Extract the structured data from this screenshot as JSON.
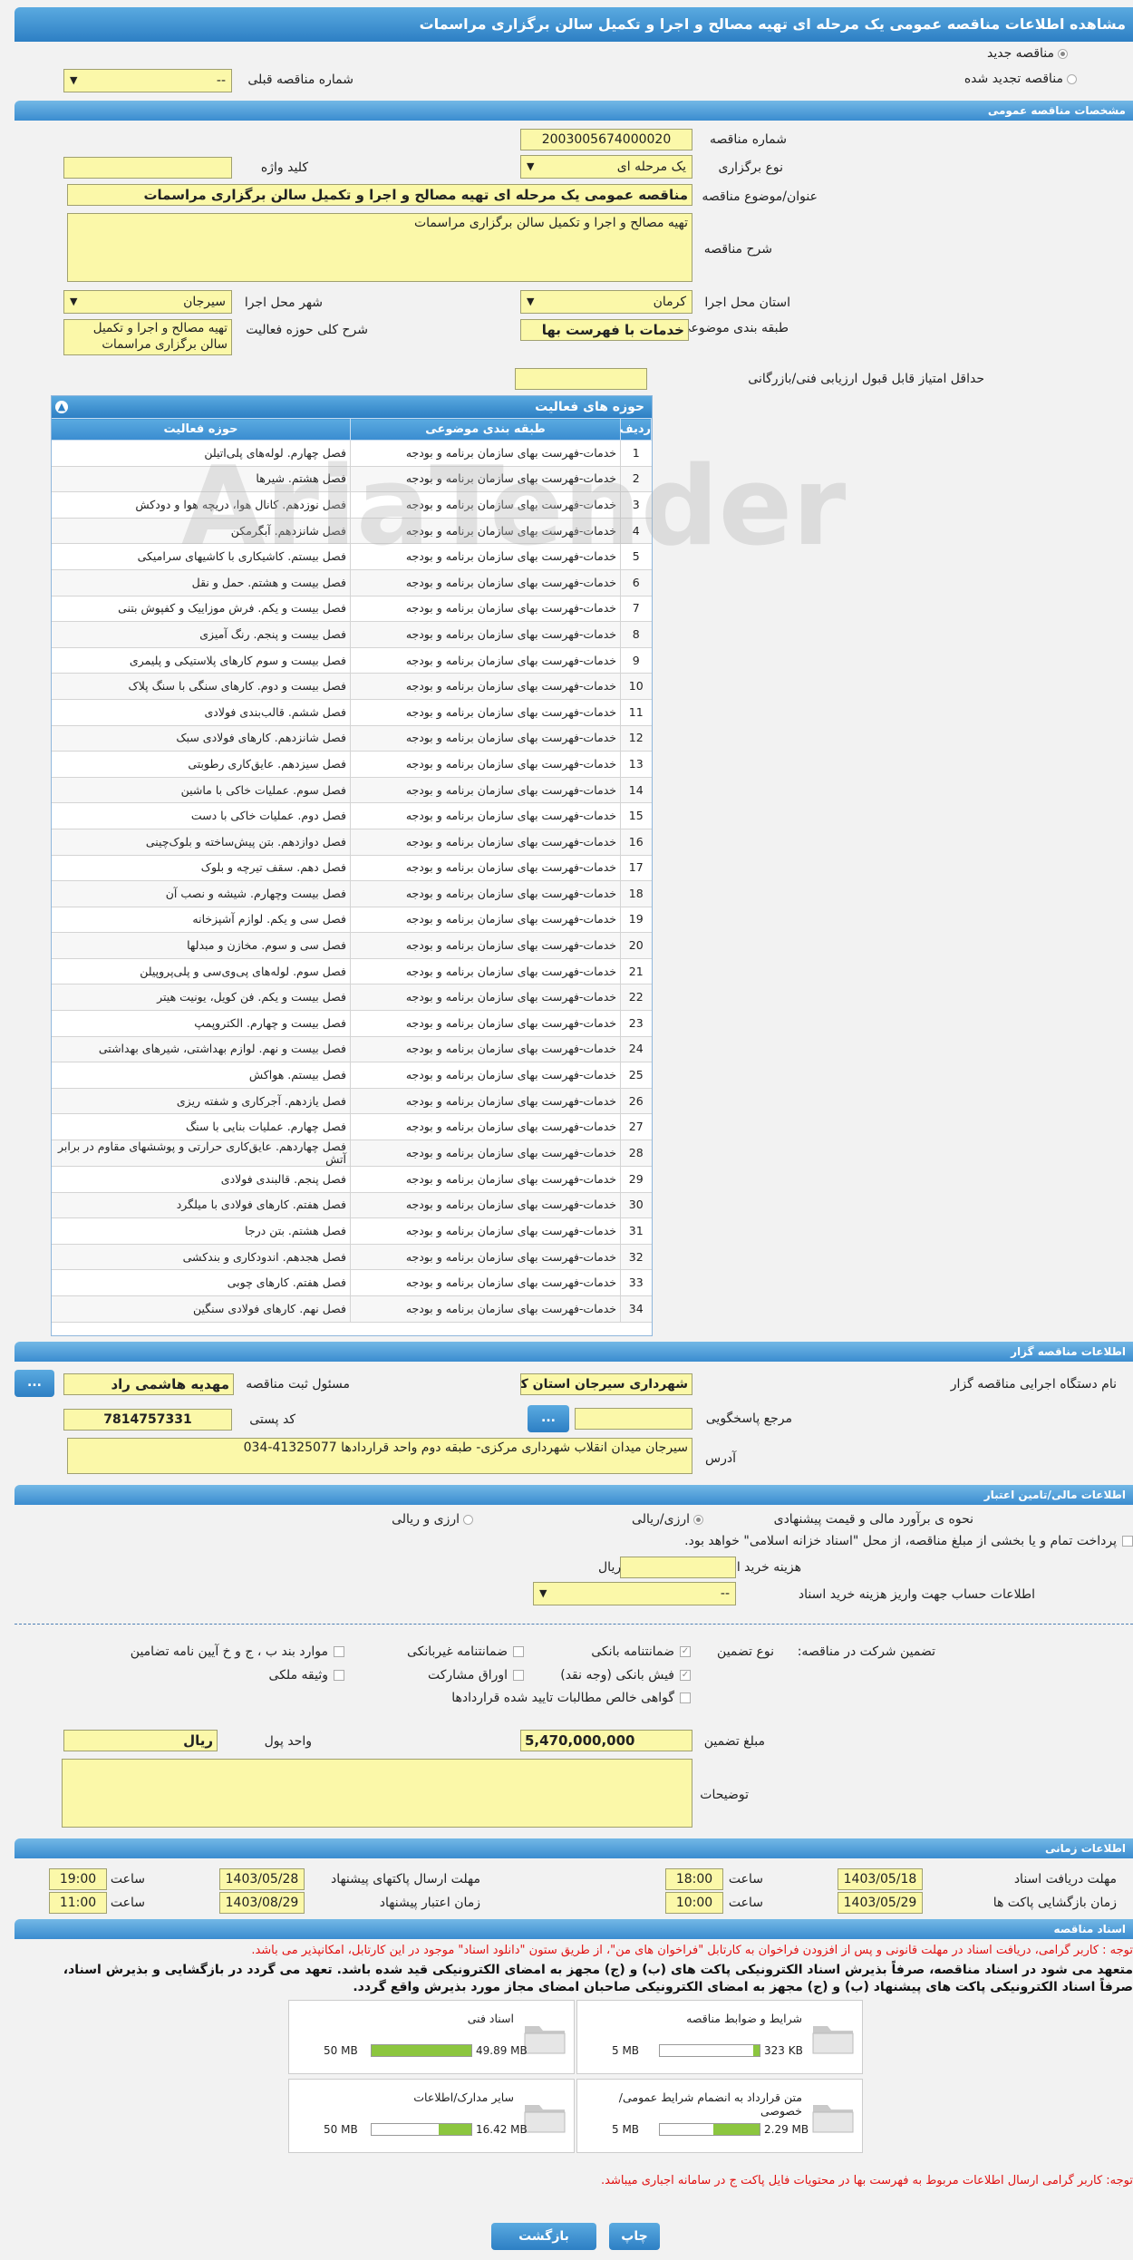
{
  "page_title": "مشاهده اطلاعات مناقصه عمومی یک مرحله ای تهیه مصالح و اجرا و تکمیل سالن برگزاری مراسمات",
  "top": {
    "radio_new": "مناقصه جدید",
    "radio_renew": "مناقصه تجدید شده",
    "prev_number_label": "شماره مناقصه قبلی",
    "prev_number_value": "--"
  },
  "sections": {
    "general": "مشخصات مناقصه عمومی",
    "organizer": "اطلاعات مناقصه گزار",
    "financial": "اطلاعات مالی/تامین اعتبار",
    "timing": "اطلاعات زمانی",
    "documents": "اسناد مناقصه"
  },
  "general": {
    "number_label": "شماره مناقصه",
    "number_value": "2003005674000020",
    "type_label": "نوع برگزاری",
    "type_value": "یک مرحله ای",
    "keyword_label": "کلید واژه",
    "keyword_value": "",
    "subject_label": "عنوان/موضوع مناقصه",
    "subject_value": "مناقصه عمومی یک مرحله ای تهیه مصالح و اجرا و تکمیل سالن برگزاری مراسمات",
    "desc_label": "شرح مناقصه",
    "desc_value": "تهیه مصالح و اجرا و تکمیل سالن برگزاری مراسمات",
    "province_label": "استان محل اجرا",
    "province_value": "کرمان",
    "city_label": "شهر محل اجرا",
    "city_value": "سیرجان",
    "category_label": "طبقه بندی موضوعی",
    "category_value": "خدمات با فهرست بها",
    "activity_desc_label": "شرح کلی حوزه فعالیت",
    "activity_desc_value": "تهیه مصالح و اجرا و تکمیل سالن برگزاری مراسمات",
    "min_score_label": "حداقل امتیاز قابل قبول ارزیابی فنی/بازرگانی",
    "min_score_value": ""
  },
  "activities": {
    "title": "حوزه های فعالیت",
    "col_row": "ردیف",
    "col_category": "طبقه بندی موضوعی",
    "col_activity": "حوزه فعالیت",
    "rows": [
      [
        "1",
        "خدمات-فهرست بهای سازمان برنامه و بودجه",
        "فصل چهارم. لوله‌های پلی‌اتیلن"
      ],
      [
        "2",
        "خدمات-فهرست بهای سازمان برنامه و بودجه",
        "فصل هشتم. شیرها"
      ],
      [
        "3",
        "خدمات-فهرست بهای سازمان برنامه و بودجه",
        "فصل نوزدهم. کانال هوا، دریچه هوا و دودکش"
      ],
      [
        "4",
        "خدمات-فهرست بهای سازمان برنامه و بودجه",
        "فصل شانزدهم. آبگرمکن"
      ],
      [
        "5",
        "خدمات-فهرست بهای سازمان برنامه و بودجه",
        "فصل بیستم. کاشیکاری با کاشیهای سرامیکی"
      ],
      [
        "6",
        "خدمات-فهرست بهای سازمان برنامه و بودجه",
        "فصل بیست و هشتم. حمل و نقل"
      ],
      [
        "7",
        "خدمات-فهرست بهای سازمان برنامه و بودجه",
        "فصل بیست و یکم. فرش موزاییک و کفپوش بتنی"
      ],
      [
        "8",
        "خدمات-فهرست بهای سازمان برنامه و بودجه",
        "فصل بیست و پنجم. رنگ آمیزی"
      ],
      [
        "9",
        "خدمات-فهرست بهای سازمان برنامه و بودجه",
        "فصل بیست و سوم کارهای پلاستیکی و پلیمری"
      ],
      [
        "10",
        "خدمات-فهرست بهای سازمان برنامه و بودجه",
        "فصل بیست و دوم. کارهای سنگی با سنگ پلاک"
      ],
      [
        "11",
        "خدمات-فهرست بهای سازمان برنامه و بودجه",
        "فصل ششم. قالب‌بندی فولادی"
      ],
      [
        "12",
        "خدمات-فهرست بهای سازمان برنامه و بودجه",
        "فصل شانزدهم. کارهای فولادی سبک"
      ],
      [
        "13",
        "خدمات-فهرست بهای سازمان برنامه و بودجه",
        "فصل سیزدهم. عایق‌کاری رطوبتی"
      ],
      [
        "14",
        "خدمات-فهرست بهای سازمان برنامه و بودجه",
        "فصل سوم. عملیات خاکی با ماشین"
      ],
      [
        "15",
        "خدمات-فهرست بهای سازمان برنامه و بودجه",
        "فصل دوم. عملیات خاکی با دست"
      ],
      [
        "16",
        "خدمات-فهرست بهای سازمان برنامه و بودجه",
        "فصل دوازدهم. بتن پیش‌ساخته و بلوک‌چینی"
      ],
      [
        "17",
        "خدمات-فهرست بهای سازمان برنامه و بودجه",
        "فصل دهم. سقف تیرچه و بلوک"
      ],
      [
        "18",
        "خدمات-فهرست بهای سازمان برنامه و بودجه",
        "فصل بیست وچهارم. شیشه و نصب آن"
      ],
      [
        "19",
        "خدمات-فهرست بهای سازمان برنامه و بودجه",
        "فصل سی و یکم. لوازم آشپزخانه"
      ],
      [
        "20",
        "خدمات-فهرست بهای سازمان برنامه و بودجه",
        "فصل سی و سوم. مخازن و مبدلها"
      ],
      [
        "21",
        "خدمات-فهرست بهای سازمان برنامه و بودجه",
        "فصل سوم. لوله‌های پی‌وی‌سی و پلی‌پروپیلن"
      ],
      [
        "22",
        "خدمات-فهرست بهای سازمان برنامه و بودجه",
        "فصل بیست و یکم. فن کویل، یونیت هیتر"
      ],
      [
        "23",
        "خدمات-فهرست بهای سازمان برنامه و بودجه",
        "فصل بیست و چهارم. الکتروپمپ"
      ],
      [
        "24",
        "خدمات-فهرست بهای سازمان برنامه و بودجه",
        "فصل بیست و نهم. لوازم بهداشتی، شیرهای بهداشتی"
      ],
      [
        "25",
        "خدمات-فهرست بهای سازمان برنامه و بودجه",
        "فصل بیستم. هواکش"
      ],
      [
        "26",
        "خدمات-فهرست بهای سازمان برنامه و بودجه",
        "فصل یازدهم. آجرکاری و شفته ریزی"
      ],
      [
        "27",
        "خدمات-فهرست بهای سازمان برنامه و بودجه",
        "فصل چهارم. عملیات بنایی با سنگ"
      ],
      [
        "28",
        "خدمات-فهرست بهای سازمان برنامه و بودجه",
        "فصل چهاردهم. عایق‌کاری حرارتی و پوششهای مقاوم در برابر آتش"
      ],
      [
        "29",
        "خدمات-فهرست بهای سازمان برنامه و بودجه",
        "فصل پنجم. قالبندی فولادی"
      ],
      [
        "30",
        "خدمات-فهرست بهای سازمان برنامه و بودجه",
        "فصل هفتم. کارهای فولادی با میلگرد"
      ],
      [
        "31",
        "خدمات-فهرست بهای سازمان برنامه و بودجه",
        "فصل هشتم. بتن درجا"
      ],
      [
        "32",
        "خدمات-فهرست بهای سازمان برنامه و بودجه",
        "فصل هجدهم. اندودکاری و بندکشی"
      ],
      [
        "33",
        "خدمات-فهرست بهای سازمان برنامه و بودجه",
        "فصل هفتم. کارهای چوبی"
      ],
      [
        "34",
        "خدمات-فهرست بهای سازمان برنامه و بودجه",
        "فصل نهم. کارهای فولادی سنگین"
      ]
    ]
  },
  "organizer": {
    "org_label": "نام دستگاه اجرایی مناقصه گزار",
    "org_value": "شهرداری سیرجان استان کرمان",
    "responsible_label": "مسئول ثبت مناقصه",
    "responsible_value": "مهدیه هاشمی راد",
    "ref_label": "مرجع پاسخگویی",
    "ref_value": "",
    "postal_label": "کد پستی",
    "postal_value": "7814757331",
    "address_label": "آدرس",
    "address_value": "سیرجان میدان انقلاب شهرداری مرکزی- طبقه دوم واحد قراردادها 41325077-034",
    "dots_button": "..."
  },
  "financial": {
    "estimate_label": "نحوه ی برآورد مالی و قیمت پیشنهادی",
    "opt_currency_rial": "ارزی/ریالی",
    "opt_currency_and_rial": "ارزی و ریالی",
    "treasury_note": "پرداخت تمام و یا بخشی از مبلغ مناقصه، از محل \"اسناد خزانه اسلامی\" خواهد بود.",
    "doc_cost_label": "هزینه خرید اسناد",
    "doc_cost_unit": "ریال",
    "account_label": "اطلاعات حساب جهت واریز هزینه خرید اسناد",
    "account_value": "--",
    "guarantee_label": "تضمین شرکت در مناقصه:",
    "guarantee_type_label": "نوع تضمین",
    "g_bank": "ضمانتنامه بانکی",
    "g_nonbank": "ضمانتنامه غیربانکی",
    "g_items": "موارد بند ب ، ج و خ آیین نامه تضامین",
    "g_cash": "فیش بانکی (وجه نقد)",
    "g_bonds": "اوراق مشارکت",
    "g_property": "وثیقه ملکی",
    "g_claims": "گواهی خالص مطالبات تایید شده قراردادها",
    "amount_label": "مبلغ تضمین",
    "amount_value": "5,470,000,000",
    "currency_label": "واحد پول",
    "currency_value": "ریال",
    "notes_label": "توضیحات",
    "notes_value": ""
  },
  "timing": {
    "receive_label": "مهلت دریافت اسناد",
    "receive_date": "1403/05/18",
    "receive_time": "18:00",
    "send_label": "مهلت ارسال پاکتهای پیشنهاد",
    "send_date": "1403/05/28",
    "send_time": "19:00",
    "open_label": "زمان بازگشایی پاکت ها",
    "open_date": "1403/05/29",
    "open_time": "10:00",
    "valid_label": "زمان اعتبار پیشنهاد",
    "valid_date": "1403/08/29",
    "valid_time": "11:00",
    "time_label": "ساعت"
  },
  "documents": {
    "note1": "توجه : کاربر گرامی، دریافت اسناد در مهلت قانونی و پس از افزودن فراخوان به کارتابل \"فراخوان های من\"، از طریق ستون \"دانلود اسناد\" موجود در این کارتابل، امکانپذیر می باشد.",
    "commit1": "متعهد می شود در اسناد مناقصه، صرفاً بذیرش اسناد الکترونیکی پاکت های (ب) و (ج) مجهز به امضای الکترونیکی قید شده باشد. تعهد می گردد در بازگشایی و بذیرش اسناد،",
    "commit2": "صرفاً اسناد الکترونیکی پاکت های پیشنهاد (ب) و (ج) مجهز به امضای الکترونیکی صاحبان امضای مجاز مورد بذیرش واقع گردد.",
    "files": [
      {
        "name": "شرایط و ضوابط مناقصه",
        "size": "323 KB",
        "max": "5 MB",
        "ratio": 0.06
      },
      {
        "name": "اسناد فنی",
        "size": "49.89 MB",
        "max": "50 MB",
        "ratio": 0.998
      },
      {
        "name": "متن قرارداد به انضمام شرایط عمومی/خصوصی",
        "size": "2.29 MB",
        "max": "5 MB",
        "ratio": 0.46
      },
      {
        "name": "سایر مدارک/اطلاعات",
        "size": "16.42 MB",
        "max": "50 MB",
        "ratio": 0.33
      }
    ],
    "note2": "توجه: کاربر گرامی ارسال اطلاعات مربوط به فهرست بها در محتویات فایل پاکت ج در سامانه اجباری میباشد."
  },
  "buttons": {
    "back": "بازگشت",
    "print": "چاپ"
  },
  "watermark": "AriaTender"
}
